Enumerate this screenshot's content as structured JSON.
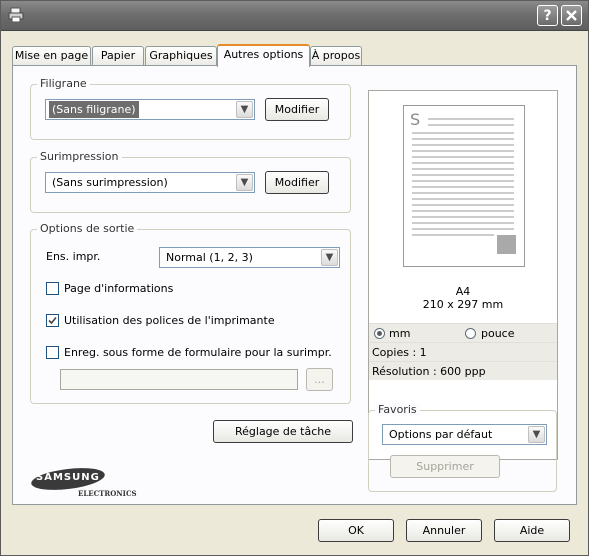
{
  "titlebar": {
    "help_label": "?",
    "close_label": "✕"
  },
  "tabs": [
    {
      "label": "Mise en page"
    },
    {
      "label": "Papier"
    },
    {
      "label": "Graphiques"
    },
    {
      "label": "Autres options"
    },
    {
      "label": "À propos"
    }
  ],
  "active_tab": "Autres options",
  "watermark": {
    "title": "Filigrane",
    "selected": "(Sans filigrane)",
    "edit_label": "Modifier"
  },
  "overlay": {
    "title": "Surimpression",
    "selected": "(Sans surimpression)",
    "edit_label": "Modifier"
  },
  "output": {
    "title": "Options de sortie",
    "print_order_label": "Ens. impr.",
    "print_order_value": "Normal (1, 2, 3)",
    "info_page_label": "Page d'informations",
    "info_page_checked": false,
    "printer_fonts_label": "Utilisation des polices de l'imprimante",
    "printer_fonts_checked": true,
    "save_overlay_label": "Enreg. sous forme de formulaire pour la surimpr.",
    "save_overlay_checked": false,
    "browse_label": "..."
  },
  "job_settings_label": "Réglage de tâche",
  "logo": {
    "brand": "SAMSUNG",
    "sub": "ELECTRONICS"
  },
  "preview": {
    "page_letter": "S",
    "paper_name": "A4",
    "paper_size": "210 x 297 mm",
    "unit_mm_label": "mm",
    "unit_inch_label": "pouce",
    "selected_unit": "mm",
    "copies": "Copies : 1",
    "resolution": "Résolution : 600 ppp"
  },
  "favorites": {
    "title": "Favoris",
    "selected": "Options par défaut",
    "delete_label": "Supprimer"
  },
  "footer": {
    "ok_label": "OK",
    "cancel_label": "Annuler",
    "help_label": "Aide"
  },
  "colors": {
    "titlebar": "#6e6e6e",
    "active_tab_accent": "#e68b2c",
    "panel_bg": "#fcfcfe",
    "dialog_bg": "#ece9d8"
  }
}
